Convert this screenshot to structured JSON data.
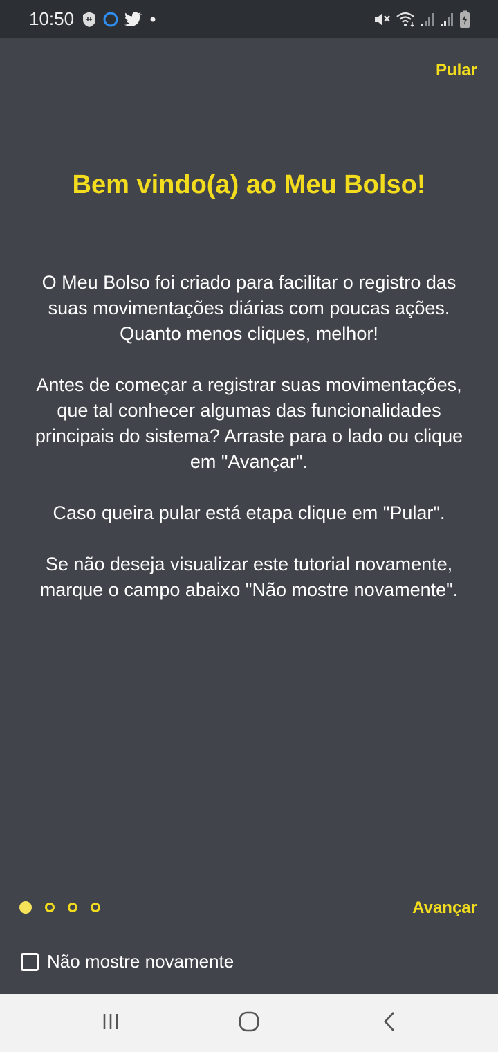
{
  "status_bar": {
    "time": "10:50",
    "left_icons": [
      "shield-app-icon",
      "circle-ring-icon",
      "twitter-icon",
      "dot-icon"
    ],
    "right_icons": [
      "mute-icon",
      "wifi-icon",
      "signal-icon",
      "signal-icon",
      "battery-charging-icon"
    ]
  },
  "onboarding": {
    "skip_label": "Pular",
    "title": "Bem vindo(a) ao Meu Bolso!",
    "paragraphs": [
      "O Meu Bolso foi criado para facilitar o registro das suas movimentações diárias com poucas ações. Quanto menos cliques, melhor!",
      "Antes de começar a registrar suas movimentações, que tal conhecer algumas das funcionalidades principais do sistema? Arraste para o lado ou clique em \"Avançar\".",
      "Caso queira pular está etapa clique em \"Pular\".",
      "Se não deseja visualizar este tutorial novamente, marque o campo abaixo \"Não mostre novamente\"."
    ],
    "page_indicator": {
      "current": 1,
      "total": 4
    },
    "next_label": "Avançar",
    "dont_show_label": "Não mostre novamente",
    "dont_show_checked": false
  },
  "colors": {
    "background": "#41444b",
    "accent": "#f2dc1d",
    "status_bar": "#2c2f33",
    "nav_bar": "#f2f2f2"
  },
  "nav_bar": {
    "buttons": [
      "recent-apps-icon",
      "home-icon",
      "back-icon"
    ]
  }
}
